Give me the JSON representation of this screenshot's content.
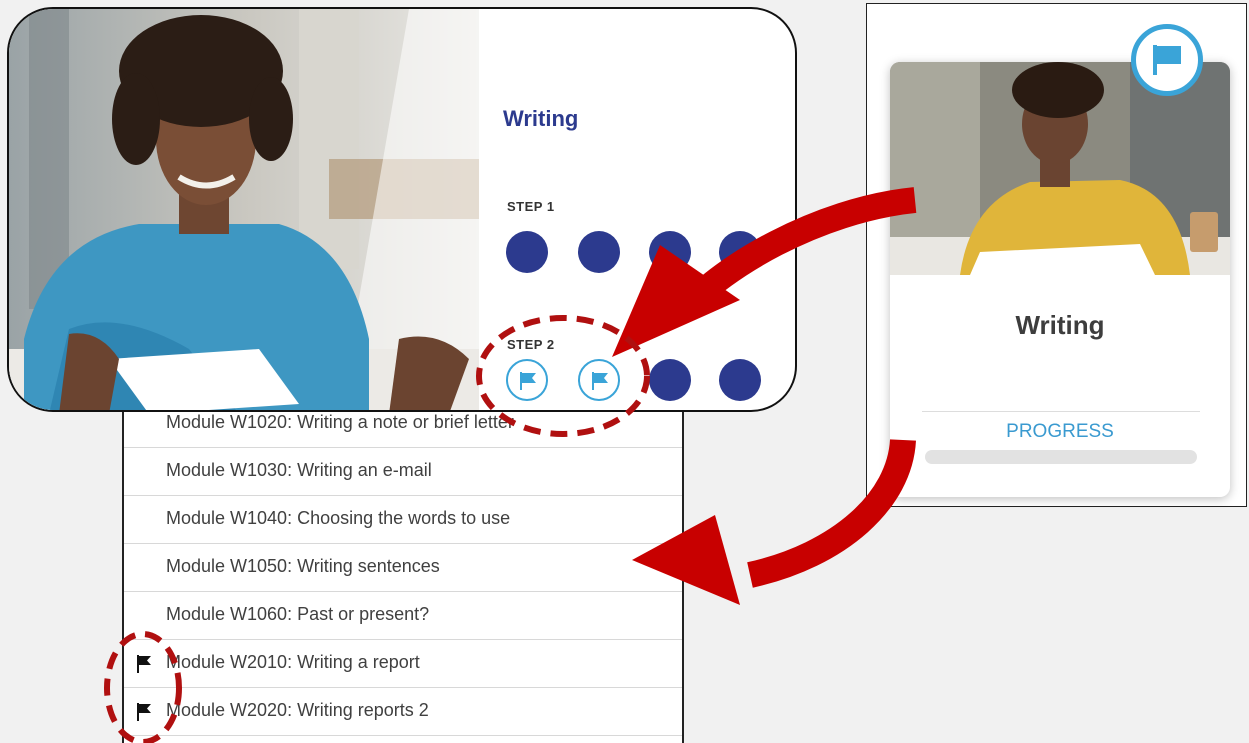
{
  "step_panel": {
    "title": "Writing",
    "steps": [
      {
        "label": "STEP 1",
        "dots": [
          {
            "state": "filled"
          },
          {
            "state": "filled"
          },
          {
            "state": "filled"
          },
          {
            "state": "filled"
          }
        ]
      },
      {
        "label": "STEP 2",
        "dots": [
          {
            "state": "flagged"
          },
          {
            "state": "flagged"
          },
          {
            "state": "filled"
          },
          {
            "state": "filled"
          }
        ]
      }
    ]
  },
  "modules": [
    {
      "label": "Module W1020: Writing a note or brief letter",
      "flagged": false
    },
    {
      "label": "Module W1030: Writing an e-mail",
      "flagged": false
    },
    {
      "label": "Module W1040: Choosing the words to use",
      "flagged": false
    },
    {
      "label": "Module W1050: Writing sentences",
      "flagged": false
    },
    {
      "label": "Module W1060: Past or present?",
      "flagged": false
    },
    {
      "label": "Module W2010: Writing a report",
      "flagged": true
    },
    {
      "label": "Module W2020: Writing reports 2",
      "flagged": true
    }
  ],
  "card": {
    "title": "Writing",
    "progress_label": "PROGRESS",
    "progress_value": 0,
    "badge_icon": "flag-icon"
  },
  "colors": {
    "accent_navy": "#2c3a8e",
    "accent_blue": "#3aa4d8",
    "arrow_red": "#c80000",
    "highlight_dashes": "#b01010"
  }
}
